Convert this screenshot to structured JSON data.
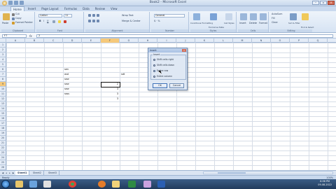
{
  "window": {
    "title": "Book2 - Microsoft Excel"
  },
  "tabs": [
    "Home",
    "Insert",
    "Page Layout",
    "Formulas",
    "Data",
    "Review",
    "View"
  ],
  "active_tab": "Home",
  "ribbon": {
    "clipboard": {
      "label": "Clipboard",
      "paste": "Paste",
      "cut": "Cut",
      "copy": "Copy",
      "format_painter": "Format Painter"
    },
    "font": {
      "label": "Font",
      "family": "Calibri",
      "size": "11"
    },
    "alignment": {
      "label": "Alignment",
      "wrap": "Wrap Text",
      "merge": "Merge & Center"
    },
    "number": {
      "label": "Number",
      "format": "General"
    },
    "styles": {
      "label": "Styles",
      "conditional": "Conditional Formatting",
      "format_table": "Format as Table",
      "cell_styles": "Cell Styles"
    },
    "cells": {
      "label": "Cells",
      "insert": "Insert",
      "delete": "Delete",
      "format": "Format"
    },
    "editing": {
      "label": "Editing",
      "autosum": "AutoSum",
      "fill": "Fill",
      "clear": "Clear",
      "sort": "Sort & Filter",
      "find": "Find & Select"
    }
  },
  "formula_bar": {
    "name_box": "F7",
    "fx": "fx",
    "content": "2"
  },
  "columns": [
    "A",
    "B",
    "C",
    "D",
    "E",
    "F",
    "G",
    "H",
    "I",
    "J",
    "K",
    "L",
    "M",
    "N",
    "O",
    "P",
    "Q",
    "R"
  ],
  "selected_column": "F",
  "rows": [
    "1",
    "2",
    "3",
    "4",
    "5",
    "6",
    "7",
    "8",
    "9",
    "10",
    "11",
    "12",
    "13",
    "14",
    "15",
    "16",
    "17",
    "18",
    "19",
    "20",
    "21",
    "22",
    "23",
    "24",
    "25",
    "26"
  ],
  "selected_row": "9",
  "cells": [
    {
      "ref": "D6",
      "text": "sen"
    },
    {
      "ref": "D7",
      "text": "asd"
    },
    {
      "ref": "G7",
      "text": "sdt"
    },
    {
      "ref": "D8",
      "text": "sew"
    },
    {
      "ref": "D9",
      "text": "sew"
    },
    {
      "ref": "F9",
      "text": "2"
    },
    {
      "ref": "D10",
      "text": "sew"
    },
    {
      "ref": "F10",
      "text": "3"
    },
    {
      "ref": "D11",
      "text": "ssss"
    },
    {
      "ref": "F11",
      "text": "3"
    },
    {
      "ref": "F12",
      "text": "3"
    }
  ],
  "dialog": {
    "title": "Insert",
    "group": "Insert",
    "options": [
      "Shift cells right",
      "Shift cells down",
      "Entire row",
      "Entire column"
    ],
    "selected_option": "Entire row",
    "ok": "OK",
    "cancel": "Cancel"
  },
  "sheets": [
    "Sheet1",
    "Sheet2",
    "Sheet3"
  ],
  "active_sheet": "Sheet1",
  "status": {
    "text": "Ready",
    "zoom": "100%"
  },
  "taskbar": {
    "time": "8:56 PM",
    "date": "09-08-2022",
    "apps": [
      "explorer",
      "media",
      "chrome",
      "firefox",
      "files",
      "excel",
      "paint",
      "word"
    ]
  },
  "colors": {
    "accent": "#1e5cb3",
    "selection": "#f6c97a",
    "ribbon": "#d6e3f3"
  }
}
